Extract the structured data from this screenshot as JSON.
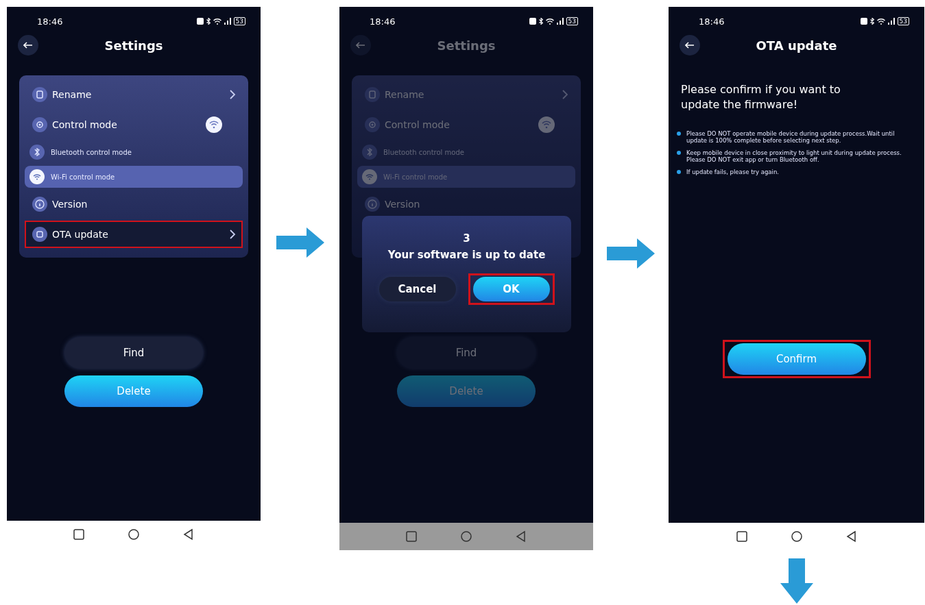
{
  "screens": [
    {
      "kind": "settings",
      "dimmed": false,
      "time": "18:46",
      "battery": "53",
      "title": "Settings",
      "menu": [
        {
          "kind": "link",
          "label": "Rename",
          "highlighted": false
        },
        {
          "kind": "mode",
          "label": "Control mode",
          "highlighted": false
        },
        {
          "kind": "option",
          "label": "Bluetooth control mode",
          "selected": false
        },
        {
          "kind": "option",
          "label": "Wi-Fi control mode",
          "selected": true
        },
        {
          "kind": "info",
          "label": "Version",
          "highlighted": false
        },
        {
          "kind": "link",
          "label": "OTA update",
          "highlighted": true
        }
      ],
      "buttons": [
        {
          "kind": "secondary",
          "label": "Find",
          "highlighted": false
        },
        {
          "kind": "primary",
          "label": "Delete",
          "highlighted": false
        }
      ]
    },
    {
      "kind": "settings",
      "dimmed": true,
      "time": "18:46",
      "battery": "53",
      "title": "Settings",
      "menu": [
        {
          "kind": "link",
          "label": "Rename",
          "highlighted": false
        },
        {
          "kind": "mode",
          "label": "Control mode",
          "highlighted": false
        },
        {
          "kind": "option",
          "label": "Bluetooth control mode",
          "selected": false
        },
        {
          "kind": "option",
          "label": "Wi-Fi control mode",
          "selected": true
        },
        {
          "kind": "info",
          "label": "Version",
          "highlighted": false
        }
      ],
      "buttons": [
        {
          "kind": "secondary",
          "label": "Find",
          "highlighted": false
        },
        {
          "kind": "primary",
          "label": "Delete",
          "highlighted": false
        }
      ],
      "dialog": {
        "count": "3",
        "message": "Your software is up to date",
        "buttons": [
          {
            "kind": "secondary",
            "label": "Cancel",
            "highlighted": false
          },
          {
            "kind": "primary",
            "label": "OK",
            "highlighted": true
          }
        ]
      }
    },
    {
      "kind": "ota",
      "dimmed": false,
      "time": "18:46",
      "battery": "53",
      "title": "OTA update",
      "heading": "Please confirm if you want to update the firmware!",
      "notes": [
        "Please DO NOT operate mobile device during update process.Wait until update is 100% complete before selecting next step.",
        "Keep mobile device in close proximity to light unit during update process. Please DO NOT exit app or turn Bluetooth off.",
        "If update fails, please try again."
      ],
      "buttons": [
        {
          "kind": "primary",
          "label": "Confirm",
          "highlighted": true
        }
      ]
    }
  ]
}
